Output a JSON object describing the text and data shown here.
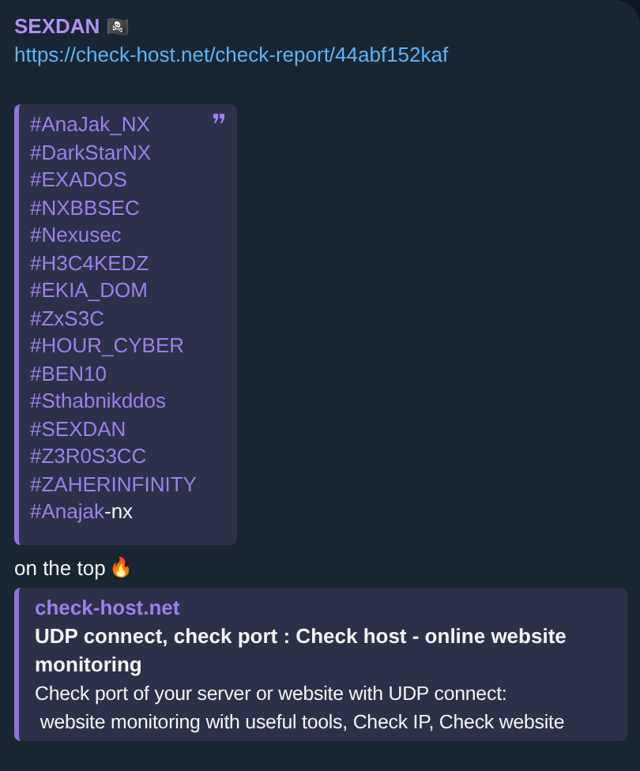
{
  "message": {
    "sender": "SEXDAN",
    "sender_emoji": "🏴‍☠️",
    "link": "https://check-host.net/check-report/44abf152kaf",
    "quote": {
      "hashtags": [
        {
          "tag": "#AnaJak_NX"
        },
        {
          "tag": "#DarkStarNX"
        },
        {
          "tag": "#EXADOS"
        },
        {
          "tag": "#NXBBSEC"
        },
        {
          "tag": "#Nexusec"
        },
        {
          "tag": "#H3C4KEDZ"
        },
        {
          "tag": "#EKIA_DOM"
        },
        {
          "tag": "#ZxS3C"
        },
        {
          "tag": "#HOUR_CYBER"
        },
        {
          "tag": "#BEN10"
        },
        {
          "tag": "#Sthabnikddos"
        },
        {
          "tag": "#SEXDAN"
        },
        {
          "tag": "#Z3R0S3CC"
        },
        {
          "tag": "#ZAHERINFINITY"
        },
        {
          "tag": "#Anajak",
          "suffix": "-nx"
        }
      ]
    },
    "text": "on the top",
    "text_emoji": "🔥",
    "preview": {
      "site": "check-host.net",
      "title": "UDP connect, check port : Check host - online website monitoring",
      "description": "Check port of your server or website with UDP connect:\n website monitoring with useful tools, Check IP, Check website"
    }
  }
}
